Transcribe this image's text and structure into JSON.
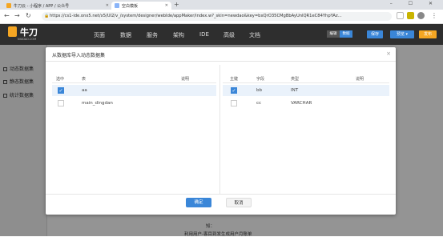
{
  "browser": {
    "tabs": [
      {
        "label": "牛刀云 - 小程序 / APP / 公众号"
      },
      {
        "label": "空白模板"
      }
    ],
    "new_tab": "+",
    "window_controls": "– ☐ ✕",
    "url": "https://cs1-ide.onx5.net/x5/UI2/v_/system/designer/webIde/appMaker/index.w?_skin=newdao&key=bxQrO35CMgBbAyUnlQR1eC84YhpYAz..."
  },
  "app": {
    "logo_text": "牛刀",
    "logo_sub": "NIUDAO.COM",
    "menu": [
      "页面",
      "数据",
      "服务",
      "架构",
      "IDE",
      "高级",
      "文档"
    ],
    "mode_tabs": [
      "编辑",
      "数据"
    ],
    "save_label": "保存",
    "preview_label": "预览",
    "publish_label": "发布"
  },
  "sidebar": {
    "items": [
      {
        "label": "动态数据集"
      },
      {
        "label": "静态数据集"
      },
      {
        "label": "统计数据集"
      }
    ]
  },
  "background": {
    "text1": "知：",
    "text2": "利用用户-客目到发生成用户月账单"
  },
  "dialog": {
    "title": "从数据库导入动态数据集",
    "close": "×",
    "left": {
      "headers": [
        "选中",
        "表",
        "说明"
      ],
      "rows": [
        {
          "name": "aa",
          "desc": "",
          "checked": true
        },
        {
          "name": "main_dingdan",
          "desc": "",
          "checked": false
        }
      ]
    },
    "right": {
      "headers": [
        "主键",
        "字段",
        "类型",
        "说明"
      ],
      "rows": [
        {
          "pk": true,
          "field": "bb",
          "type": "INT",
          "desc": ""
        },
        {
          "pk": false,
          "field": "cc",
          "type": "VARCHAR",
          "desc": ""
        }
      ]
    },
    "ok_label": "确定",
    "cancel_label": "取消"
  },
  "colors": {
    "accent": "#3a86d8",
    "header_bg": "#2e2e2e",
    "logo": "#f5a623"
  }
}
